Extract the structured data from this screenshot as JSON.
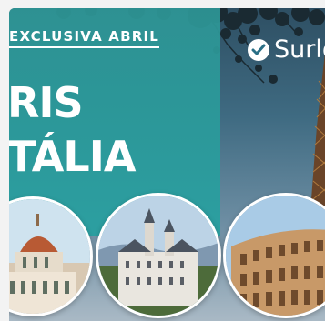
{
  "promo": {
    "tagline": "EXCLUSIVA ABRIL",
    "headline_line1": "RIS",
    "headline_line2": "TÁLIA"
  },
  "brand": {
    "name": "Surlo",
    "logo_icon": "checkmark-circle-icon"
  },
  "photos": [
    {
      "icon": "florence-cathedral-photo"
    },
    {
      "icon": "neuschwanstein-castle-photo"
    },
    {
      "icon": "colosseum-photo"
    }
  ],
  "colors": {
    "teal_panel": "#2a9d9d",
    "text": "#ffffff",
    "sky": "#3f6b82"
  }
}
